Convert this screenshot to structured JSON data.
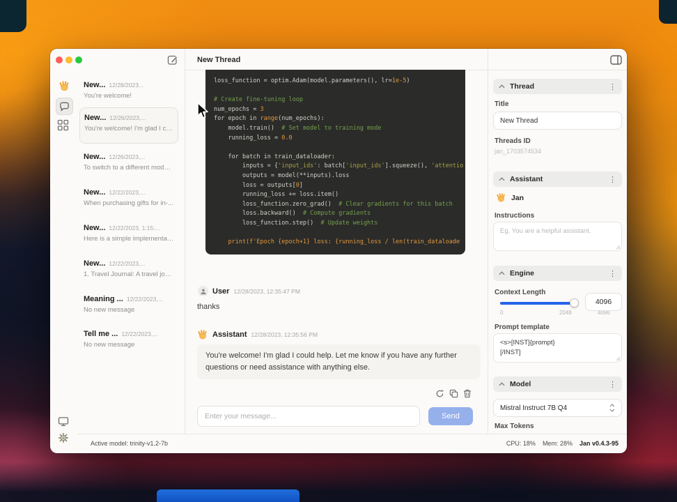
{
  "titlebar": {
    "title": "New Thread"
  },
  "icons": {
    "kebab": "⋮",
    "compose": "pencil-square",
    "panel_toggle": "sidebar-right",
    "wave": "waving-hand",
    "chat": "speech-bubble",
    "apps": "grid-squares",
    "monitor": "display",
    "settings": "gear",
    "regenerate": "circular-arrows",
    "copy": "overlapping-squares",
    "delete": "trash-can",
    "user_avatar": "person-circle",
    "collapse": "chevron-up",
    "select": "up-down-chevrons"
  },
  "threads": [
    {
      "title": "New...",
      "date": "12/28/2023...",
      "preview": "You're welcome!"
    },
    {
      "title": "New...",
      "date": "12/26/2023,...",
      "preview": "You're welcome! I'm glad I cou..."
    },
    {
      "title": "New...",
      "date": "12/26/2023,...",
      "preview": "To switch to a different model,..."
    },
    {
      "title": "New...",
      "date": "12/22/2023,...",
      "preview": "When purchasing gifts for in-..."
    },
    {
      "title": "New...",
      "date": "12/22/2023, 1:15:...",
      "preview": "Here is a simple implementati..."
    },
    {
      "title": "New...",
      "date": "12/22/2023,...",
      "preview": "1. Travel Journal: A travel journ..."
    },
    {
      "title": "Meaning ...",
      "date": "12/22/2023,...",
      "preview": "No new message"
    },
    {
      "title": "Tell me ...",
      "date": "12/22/2023,...",
      "preview": "No new message"
    }
  ],
  "chat": {
    "code_lines": [
      "loss_function = optim.Adam(model.parameters(), lr=1e-5)",
      "",
      "# Create fine-tuning loop",
      "num_epochs = 3",
      "for epoch in range(num_epochs):",
      "    model.train()  # Set model to training mode",
      "    running_loss = 0.0",
      "",
      "    for batch in train_dataloader:",
      "        inputs = {'input_ids': batch['input_ids'].squeeze(), 'attentio",
      "        outputs = model(**inputs).loss",
      "        loss = outputs[0]",
      "        running_loss += loss.item()",
      "        loss_function.zero_grad()  # Clear gradients for this batch",
      "        loss.backward()  # Compute gradients",
      "        loss_function.step()  # Update weights",
      "",
      "    print(f'Epoch {epoch+1} loss: {running_loss / len(train_dataloade"
    ],
    "messages": [
      {
        "role": "User",
        "timestamp": "12/28/2023, 12:35:47 PM",
        "text": "thanks"
      },
      {
        "role": "Assistant",
        "timestamp": "12/28/2023, 12:35:56 PM",
        "text": "You're welcome! I'm glad I could help. Let me know if you have any further questions or need assistance with anything else."
      }
    ],
    "input_placeholder": "Enter your message...",
    "send_label": "Send"
  },
  "panels": {
    "thread": {
      "header": "Thread",
      "title_label": "Title",
      "title_value": "New Thread",
      "id_label": "Threads ID",
      "id_value": "jan_1703574534"
    },
    "assistant": {
      "header": "Assistant",
      "name": "Jan",
      "instructions_label": "Instructions",
      "instructions_placeholder": "Eg. You are a helpful assistant."
    },
    "engine": {
      "header": "Engine",
      "context_label": "Context Length",
      "tick_min": "0",
      "tick_mid": "2048",
      "tick_max": "4096",
      "context_value": "4096",
      "context_percent": 100,
      "template_label": "Prompt template",
      "template_value": "<s>[INST]{prompt}\n[/INST]"
    },
    "model": {
      "header": "Model",
      "selected": "Mistral Instruct 7B Q4",
      "max_tokens_label": "Max Tokens"
    }
  },
  "status": {
    "active_model": "Active model: trinity-v1.2-7b",
    "cpu": "CPU: 18%",
    "mem": "Mem: 28%",
    "version": "Jan v0.4.3-95"
  },
  "colors": {
    "accent_blue": "#2563eb",
    "send_button": "#96b0ec",
    "code_bg": "#2b2b29",
    "code_comment": "#74a14e",
    "code_string": "#a8a243",
    "code_number": "#e2993e",
    "traffic_red": "#ff5f57",
    "traffic_yellow": "#febc2e",
    "traffic_green": "#28c840"
  }
}
